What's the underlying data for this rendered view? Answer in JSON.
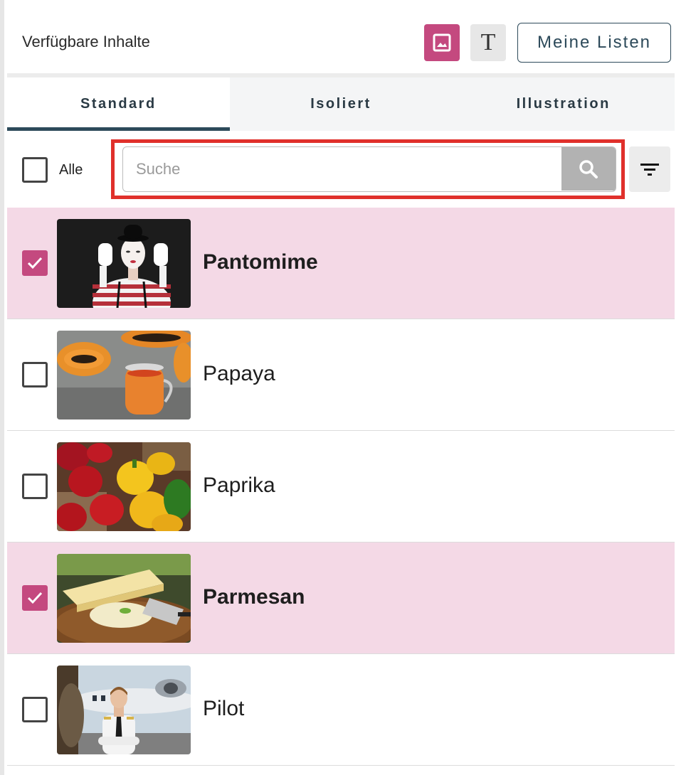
{
  "header": {
    "title": "Verfügbare Inhalte",
    "mode_image_icon": "image-icon",
    "mode_text_icon": "text-icon",
    "mode_text_glyph": "T",
    "lists_button": "Meine Listen",
    "accent_color": "#c4497f"
  },
  "tabs": [
    {
      "label": "Standard",
      "active": true
    },
    {
      "label": "Isoliert",
      "active": false
    },
    {
      "label": "Illustration",
      "active": false
    }
  ],
  "toolbar": {
    "select_all_label": "Alle",
    "select_all_checked": false,
    "search_placeholder": "Suche",
    "search_value": "",
    "search_icon": "search-icon",
    "filter_icon": "filter-icon"
  },
  "items": [
    {
      "label": "Pantomime",
      "checked": true,
      "thumb_icon": "mime-photo"
    },
    {
      "label": "Papaya",
      "checked": false,
      "thumb_icon": "papaya-photo"
    },
    {
      "label": "Paprika",
      "checked": false,
      "thumb_icon": "paprika-photo"
    },
    {
      "label": "Parmesan",
      "checked": true,
      "thumb_icon": "parmesan-photo"
    },
    {
      "label": "Pilot",
      "checked": false,
      "thumb_icon": "pilot-photo"
    }
  ]
}
